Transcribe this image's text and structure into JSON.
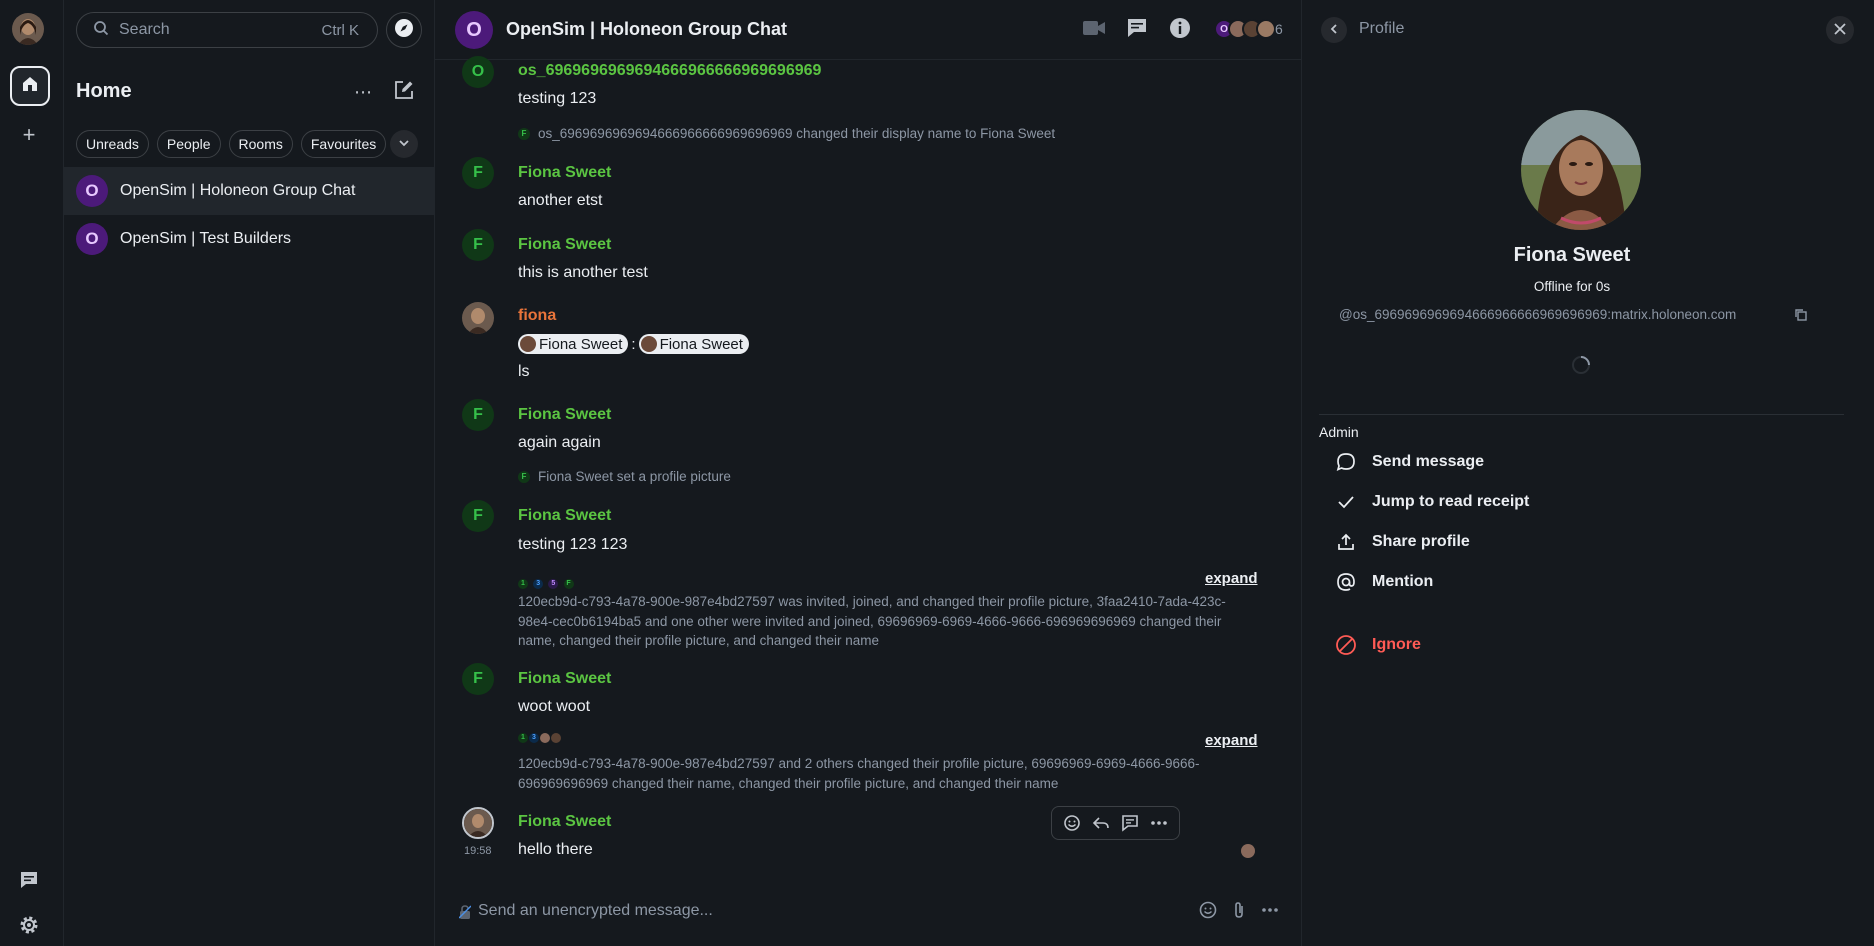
{
  "rail": {
    "user_avatar": "user-avatar",
    "home_icon": "home-icon",
    "add_space": "+",
    "threads_icon": "threads-icon",
    "settings_icon": "gear-icon"
  },
  "roomlist": {
    "search_placeholder": "Search",
    "search_shortcut": "Ctrl K",
    "title": "Home",
    "more": "⋯",
    "filters": [
      "Unreads",
      "People",
      "Rooms",
      "Favourites"
    ],
    "rooms": [
      {
        "initial": "O",
        "name": "OpenSim | Holoneon Group Chat",
        "active": true
      },
      {
        "initial": "O",
        "name": "OpenSim | Test Builders",
        "active": false
      }
    ]
  },
  "room": {
    "initial": "O",
    "title": "OpenSim | Holoneon Group Chat",
    "member_count": "6",
    "face_initial": "O"
  },
  "timeline": {
    "m1": {
      "initial": "O",
      "sender": "os_6969696969694666966666969696969",
      "body": "testing 123"
    },
    "s1": {
      "initial": "F",
      "text": "os_6969696969694666966666969696969 changed their display name to Fiona Sweet"
    },
    "m2": {
      "initial": "F",
      "sender": "Fiona Sweet",
      "body": "another etst"
    },
    "m3": {
      "initial": "F",
      "sender": "Fiona Sweet",
      "body": "this is another test"
    },
    "m4": {
      "sender": "fiona",
      "pill1": "Fiona Sweet",
      "pill_sep": ":",
      "pill2": "Fiona Sweet",
      "body": "ls"
    },
    "m5": {
      "initial": "F",
      "sender": "Fiona Sweet",
      "body": "again again"
    },
    "s2": {
      "initial": "F",
      "text": "Fiona Sweet set a profile picture"
    },
    "m6": {
      "initial": "F",
      "sender": "Fiona Sweet",
      "body": "testing 123 123"
    },
    "g1": {
      "avatars": [
        "1",
        "3",
        "5",
        "F"
      ],
      "expand": "expand",
      "line1": "120ecb9d-c793-4a78-900e-987e4bd27597 was invited, joined, and changed their profile picture, 3faa2410-7ada-423c-",
      "line2": "98e4-cec0b6194ba5 and one other were invited and joined, 69696969-6969-4666-9666-696969696969 changed their",
      "line3": "name, changed their profile picture, and changed their name"
    },
    "m7": {
      "initial": "F",
      "sender": "Fiona Sweet",
      "body": "woot woot"
    },
    "g2": {
      "avatars": [
        "1",
        "3"
      ],
      "expand": "expand",
      "line1": "120ecb9d-c793-4a78-900e-987e4bd27597 and 2 others changed their profile picture, 69696969-6969-4666-9666-",
      "line2": "696969696969 changed their name, changed their profile picture, and changed their name"
    },
    "m8": {
      "sender": "Fiona Sweet",
      "time": "19:58",
      "body": "hello there"
    }
  },
  "composer": {
    "placeholder": "Send an unencrypted message..."
  },
  "profile": {
    "header": "Profile",
    "name": "Fiona Sweet",
    "presence": "Offline for 0s",
    "mxid": "@os_6969696969694666966666969696969:matrix.holoneon.com",
    "role": "Admin",
    "actions": {
      "send_message": "Send message",
      "read_receipt": "Jump to read receipt",
      "share": "Share profile",
      "mention": "Mention",
      "ignore": "Ignore"
    }
  },
  "colors": {
    "background": "#15191e",
    "sender_green": "#5bc542",
    "sender_orange": "#e8743a",
    "room_avatar": "#4c1a7a",
    "danger": "#ff5b55"
  }
}
